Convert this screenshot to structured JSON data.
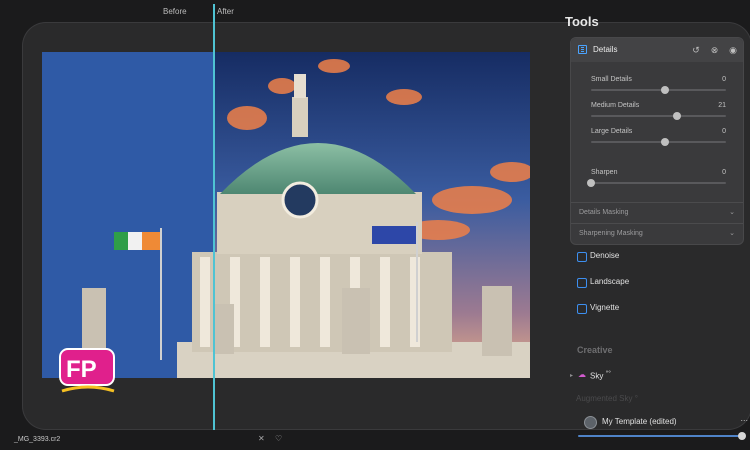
{
  "header": {
    "before_label": "Before",
    "after_label": "After"
  },
  "tools_panel": {
    "title": "Tools",
    "details": {
      "title": "Details",
      "sliders": [
        {
          "label": "Small Details",
          "value": "0",
          "level": 0.55
        },
        {
          "label": "Medium Details",
          "value": "21",
          "level": 0.64
        },
        {
          "label": "Large Details",
          "value": "0",
          "level": 0.55
        },
        {
          "label": "Sharpen",
          "value": "0",
          "level": 0
        }
      ],
      "masking": [
        {
          "label": "Details Masking",
          "icon": "chevron-down-icon"
        },
        {
          "label": "Sharpening Masking",
          "icon": "chevron-down-icon"
        }
      ],
      "header_icons": [
        "reset-icon",
        "hide-icon",
        "toggle-icon"
      ]
    },
    "tools": [
      {
        "label": "Denoise",
        "icon": "denoise-icon"
      },
      {
        "label": "Landscape",
        "icon": "landscape-icon"
      },
      {
        "label": "Vignette",
        "icon": "vignette-icon"
      }
    ],
    "creative": {
      "heading": "Creative",
      "sky_label": "Sky",
      "sky_badge": "°°",
      "augmented_sky_label": "Augmented Sky °"
    }
  },
  "template": {
    "name": "My Template (edited)",
    "more": "...",
    "progress": 1.0
  },
  "file": {
    "name": "_MG_3393.cr2"
  },
  "bottom_icons": [
    "close-icon",
    "heart-icon"
  ],
  "colors": {
    "accent": "#4aa3ff",
    "split": "#4fc3d3",
    "sky_icon": "#d35bd0",
    "logo_pink": "#e0208c"
  }
}
